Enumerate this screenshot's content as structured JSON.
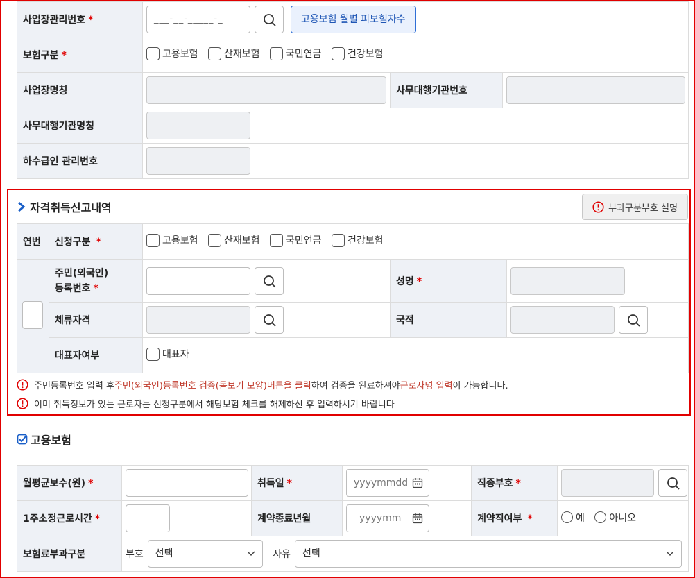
{
  "top": {
    "biz_no_label": "사업장관리번호",
    "biz_no_mask": "___-__-_____-_",
    "monthly_btn": "고용보험 월별 피보험자수",
    "ins_type_label": "보험구분",
    "ins_types": [
      "고용보험",
      "산재보험",
      "국민연금",
      "건강보험"
    ],
    "biz_name_label": "사업장명칭",
    "agency_no_label": "사무대행기관번호",
    "agency_name_label": "사무대행기관명칭",
    "sub_no_label": "하수급인 관리번호"
  },
  "acq": {
    "title": "자격취득신고내역",
    "help_btn": "부과구분부호 설명",
    "seq_label": "연번",
    "apply_label": "신청구분",
    "ins_types": [
      "고용보험",
      "산재보험",
      "국민연금",
      "건강보험"
    ],
    "rrn_label_1": "주민(외국인)",
    "rrn_label_2": "등록번호",
    "name_label": "성명",
    "stay_label": "체류자격",
    "nation_label": "국적",
    "rep_label": "대표자여부",
    "rep_option": "대표자",
    "notice1": {
      "a": "주민등록번호 입력 후 ",
      "b": "주민(외국인)등록번호 검증(돋보기 모양)버튼을 클릭",
      "c": "하여 검증을 완료하셔야 ",
      "d": "근로자명 입력",
      "e": "이 가능합니다."
    },
    "notice2": "이미 취득정보가 있는 근로자는 신청구분에서 해당보험 체크를 해제하신 후 입력하시기 바랍니다"
  },
  "emp": {
    "title": "고용보험",
    "wage_label": "월평균보수(원)",
    "acq_date_label": "취득일",
    "acq_date_ph": "yyyymmdd",
    "job_label": "직종부호",
    "hours_label": "1주소정근로시간",
    "contract_end_label": "계약종료년월",
    "contract_end_ph": "yyyymm",
    "contract_label": "계약직여부",
    "yes": "예",
    "no": "아니오",
    "premium_label": "보험료부과구분",
    "code_label": "부호",
    "code_value": "선택",
    "reason_label": "사유",
    "reason_value": "선택"
  },
  "colors": {
    "required": "#e00000",
    "frame": "#e10000",
    "accent_blue": "#1f56b5",
    "highlight": "#c0392b"
  }
}
